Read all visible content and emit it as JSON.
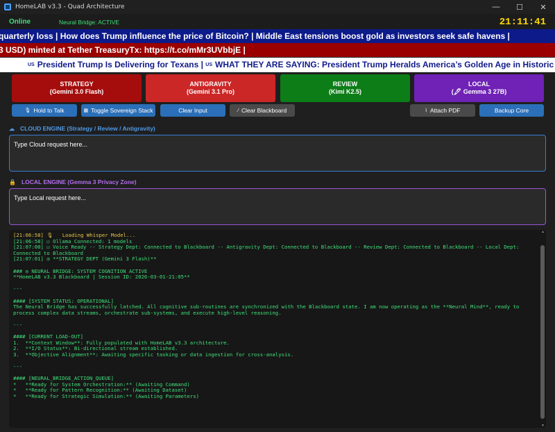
{
  "window": {
    "title": "HomeLAB v3.3 - Quad Architecture",
    "controls": {
      "minimize": "—",
      "maximize": "☐",
      "close": "✕"
    }
  },
  "status": {
    "online": "Online",
    "bridge": "Neural Bridge: ACTIVE",
    "clock": "21:11:41"
  },
  "tickers": [
    "quarterly loss | How does Trump influence the price of Bitcoin? | Middle East tensions boost gold as investors seek safe havens |",
    "3 USD) minted at Tether TreasuryTx: https://t.co/mMr3UVbbjE |",
    "President Trump Is Delivering for Texans |",
    "WHAT THEY ARE SAYING: President Trump Heralds America’s Golden Age in Historic State of th"
  ],
  "ticker_flag": "US",
  "modes": [
    {
      "name": "STRATEGY",
      "model": "(Gemini 3.0 Flash)"
    },
    {
      "name": "ANTIGRAVITY",
      "model": "(Gemini 3.1 Pro)"
    },
    {
      "name": "REVIEW",
      "model": "(Kimi K2.5)"
    },
    {
      "name": "LOCAL",
      "model": "(🖋 Gemma 3 27B)"
    }
  ],
  "actions": {
    "hold_to_talk": "Hold to Talk",
    "toggle_stack": "Toggle Sovereign Stack",
    "clear_input": "Clear Input",
    "clear_blackboard": "Clear Blackboard",
    "attach_pdf": "Attach PDF",
    "backup_core": "Backup Core"
  },
  "cloud": {
    "label": "CLOUD ENGINE (Strategy / Review / Antigravity)",
    "placeholder": "Type Cloud request here..."
  },
  "local": {
    "label": "LOCAL ENGINE (Gemma 3 Privacy Zone)",
    "placeholder": "Type Local request here..."
  },
  "console": [
    {
      "text": "[21:06:58] 🎙   Loading Whisper Model...",
      "dim": true
    },
    {
      "text": "[21:06:58] ☑ Ollama Connected: 1 models"
    },
    {
      "text": "[21:07:00] ☑ Voice Ready -- Strategy Dept: Connected to Blackboard -- Antigravity Dept: Connected to Blackboard -- Review Dept: Connected to Blackboard -- Local Dept: Connected to Blackboard"
    },
    {
      "text": "[21:07:01] ◎ **STRATEGY DEPT (Gemini 3 Flash)**"
    },
    {
      "text": " "
    },
    {
      "text": "### ◎ NEURAL BRIDGE: SYSTEM COGNITION ACTIVE"
    },
    {
      "text": "**HomeLAB v3.3 Blackboard | Session ID: 2026-03-01-21:05**"
    },
    {
      "text": " "
    },
    {
      "text": "---"
    },
    {
      "text": " "
    },
    {
      "text": "#### [SYSTEM STATUS: OPERATIONAL]"
    },
    {
      "text": "The Neural Bridge has successfully latched. All cognitive sub-routines are synchronized with the Blackboard state. I am now operating as the **Neural Mind**, ready to process complex data streams, orchestrate sub-systems, and execute high-level reasoning."
    },
    {
      "text": " "
    },
    {
      "text": "---"
    },
    {
      "text": " "
    },
    {
      "text": "#### [CURRENT LOAD-OUT]"
    },
    {
      "text": "1.  **Context Window**: Fully populated with HomeLAB v3.3 architecture."
    },
    {
      "text": "2.  **I/O Status**: Bi-directional stream established."
    },
    {
      "text": "3.  **Objective Alignment**: Awaiting specific tasking or data ingestion for cross-analysis."
    },
    {
      "text": " "
    },
    {
      "text": "---"
    },
    {
      "text": " "
    },
    {
      "text": "#### [NEURAL_BRIDGE_ACTION_QUEUE]"
    },
    {
      "text": "*   **Ready for System Orchestration:** (Awaiting Command)"
    },
    {
      "text": "*   **Ready for Pattern Recognition:** (Awaiting Dataset)"
    },
    {
      "text": "*   **Ready for Strategic Simulation:** (Awaiting Parameters)"
    }
  ]
}
